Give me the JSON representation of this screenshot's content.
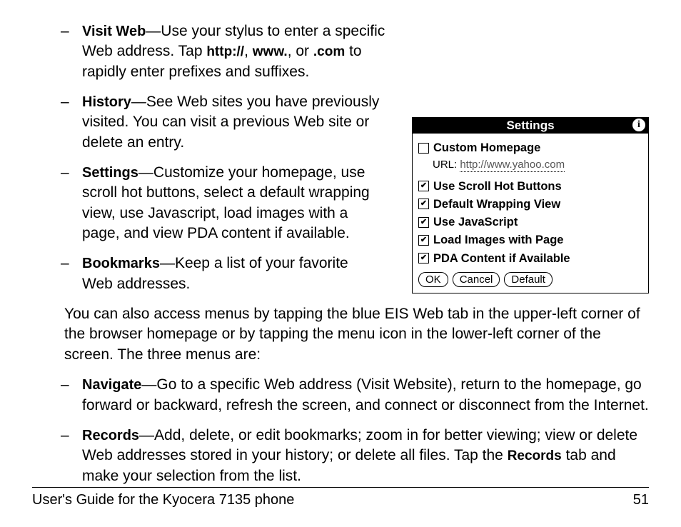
{
  "items1": [
    {
      "term": "Visit Web",
      "text_before_1": "—Use your stylus to enter a specific Web address. Tap ",
      "inline1": "http://",
      "mid1": ", ",
      "inline2": "www.",
      "mid2": ", or ",
      "inline3": ".com",
      "text_after": " to rapidly enter prefixes and suffixes."
    },
    {
      "term": "History",
      "text": "—See Web sites you have previously visited. You can visit a previous Web site or delete an entry."
    },
    {
      "term": "Settings",
      "text": "—Customize your homepage, use scroll hot buttons, select a default wrapping view, use Javascript, load images with a page, and view PDA content if available."
    },
    {
      "term": "Bookmarks",
      "text": "—Keep a list of your favorite Web addresses."
    }
  ],
  "para1": "You can also access menus by tapping the blue EIS Web tab in the upper-left corner of the browser homepage or by tapping the menu icon in the lower-left corner of the screen. The three menus are:",
  "items2": [
    {
      "term": "Navigate",
      "text": "—Go to a specific Web address (Visit Website), return to the homepage, go forward or backward, refresh the screen, and connect or disconnect from the Internet."
    },
    {
      "term": "Records",
      "pre": "—Add, delete, or edit bookmarks; zoom in for better viewing; view or delete Web addresses stored in your history; or delete all files. Tap the ",
      "inline": "Records",
      "post": " tab and make your selection from the list."
    }
  ],
  "fig": {
    "title": "Settings",
    "info": "i",
    "custom": "Custom Homepage",
    "url_label": "URL: ",
    "url_value": "http://www.yahoo.com",
    "opts": [
      "Use Scroll Hot Buttons",
      "Default Wrapping View",
      "Use JavaScript",
      "Load Images with Page",
      "PDA Content if Available"
    ],
    "buttons": {
      "ok": "OK",
      "cancel": "Cancel",
      "default": "Default"
    }
  },
  "footer": {
    "left": "User's Guide for the Kyocera 7135 phone",
    "right": "51"
  },
  "glyphs": {
    "dash": "–",
    "check": "✔"
  }
}
